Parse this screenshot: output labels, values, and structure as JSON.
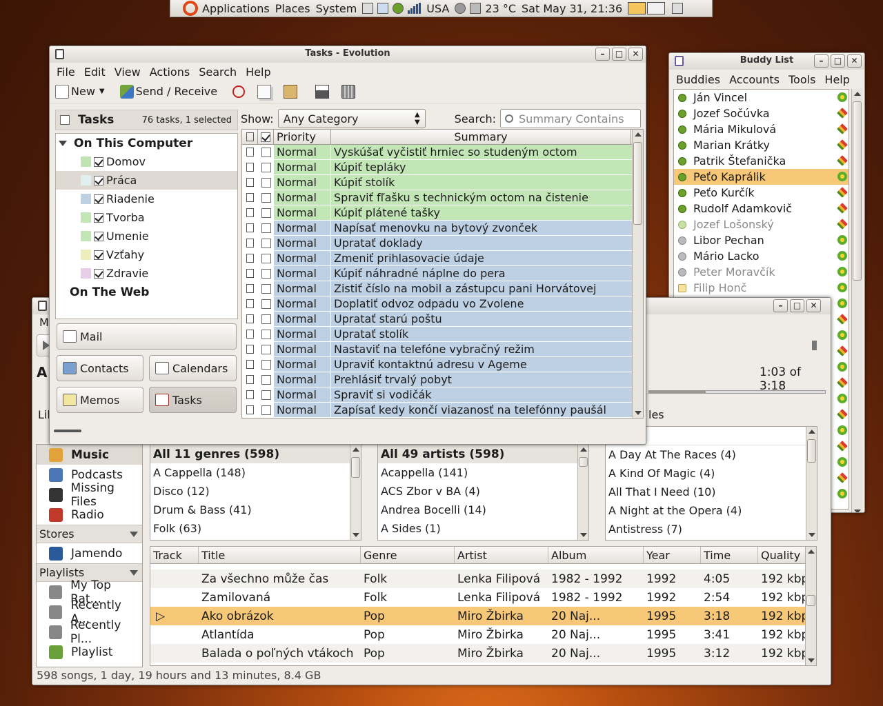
{
  "top_panel": {
    "menus": [
      "Applications",
      "Places",
      "System"
    ],
    "keyboard_layout": "USA",
    "temperature": "23 °C",
    "clock": "Sat May 31, 21:36"
  },
  "evolution": {
    "title": "Tasks - Evolution",
    "menu": [
      "File",
      "Edit",
      "View",
      "Actions",
      "Search",
      "Help"
    ],
    "toolbar": {
      "new_label": "New",
      "send_receive_label": "Send / Receive"
    },
    "sidebar": {
      "title": "Tasks",
      "count": "76 tasks, 1 selected",
      "groups": [
        "On This Computer",
        "On The Web"
      ],
      "lists": [
        {
          "label": "Domov",
          "color": "#bfe3b2",
          "checked": true
        },
        {
          "label": "Práca",
          "color": "#dff0ee",
          "checked": true
        },
        {
          "label": "Riadenie",
          "color": "#bdd0e4",
          "checked": true
        },
        {
          "label": "Tvorba",
          "color": "#c3e6b6",
          "checked": true
        },
        {
          "label": "Umenie",
          "color": "#c3e6b6",
          "checked": true
        },
        {
          "label": "Vzťahy",
          "color": "#eeeebd",
          "checked": true
        },
        {
          "label": "Zdravie",
          "color": "#e7cde7",
          "checked": true
        }
      ],
      "buttons": {
        "mail": "Mail",
        "contacts": "Contacts",
        "calendars": "Calendars",
        "memos": "Memos",
        "tasks": "Tasks"
      }
    },
    "filter": {
      "show_label": "Show:",
      "category": "Any Category",
      "search_label": "Search:",
      "search_placeholder": "Summary Contains"
    },
    "table": {
      "headers": [
        "Priority",
        "Summary"
      ],
      "rows": [
        {
          "priority": "Normal",
          "summary": "Vyskúšať vyčistiť hrniec so studeným octom",
          "color": "#c3e6b6"
        },
        {
          "priority": "Normal",
          "summary": "Kúpiť tepláky",
          "color": "#c3e6b6"
        },
        {
          "priority": "Normal",
          "summary": "Kúpiť stolík",
          "color": "#c3e6b6"
        },
        {
          "priority": "Normal",
          "summary": "Spraviť fľašku s technickým octom na čistenie",
          "color": "#c3e6b6"
        },
        {
          "priority": "Normal",
          "summary": "Kúpiť plátené tašky",
          "color": "#c3e6b6"
        },
        {
          "priority": "Normal",
          "summary": "Napísať menovku na bytový zvonček",
          "color": "#bdd0e4"
        },
        {
          "priority": "Normal",
          "summary": "Upratať doklady",
          "color": "#bdd0e4"
        },
        {
          "priority": "Normal",
          "summary": "Zmeniť prihlasovacie údaje",
          "color": "#bdd0e4"
        },
        {
          "priority": "Normal",
          "summary": "Kúpiť náhradné náplne do pera",
          "color": "#bdd0e4"
        },
        {
          "priority": "Normal",
          "summary": "Zistiť číslo na mobil a zástupcu pani Horvátovej",
          "color": "#bdd0e4"
        },
        {
          "priority": "Normal",
          "summary": "Doplatiť odvoz odpadu vo Zvolene",
          "color": "#bdd0e4"
        },
        {
          "priority": "Normal",
          "summary": "Upratať starú poštu",
          "color": "#bdd0e4"
        },
        {
          "priority": "Normal",
          "summary": "Upratať stolík",
          "color": "#bdd0e4"
        },
        {
          "priority": "Normal",
          "summary": "Nastaviť na telefóne vybračný režim",
          "color": "#bdd0e4"
        },
        {
          "priority": "Normal",
          "summary": "Upraviť kontaktnú adresu v Ageme",
          "color": "#bdd0e4"
        },
        {
          "priority": "Normal",
          "summary": "Prehlásiť trvalý pobyt",
          "color": "#bdd0e4"
        },
        {
          "priority": "Normal",
          "summary": "Spraviť si vodičák",
          "color": "#bdd0e4"
        },
        {
          "priority": "Normal",
          "summary": "Zapísať kedy končí viazanosť na telefónny paušál",
          "color": "#bdd0e4"
        }
      ]
    }
  },
  "buddy_list": {
    "title": "Buddy List",
    "menu": [
      "Buddies",
      "Accounts",
      "Tools",
      "Help"
    ],
    "buddies": [
      {
        "name": "Ján Vincel",
        "status": "online",
        "proto": "icq"
      },
      {
        "name": "Jozef Sočúvka",
        "status": "online",
        "proto": "gg"
      },
      {
        "name": "Mária Mikulová",
        "status": "online",
        "proto": "gg"
      },
      {
        "name": "Marian Krátky",
        "status": "online",
        "proto": "gg"
      },
      {
        "name": "Patrik Štefanička",
        "status": "online",
        "proto": "gg"
      },
      {
        "name": "Peťo Kaprálik",
        "status": "online",
        "proto": "icq",
        "selected": true
      },
      {
        "name": "Peťo Kurčík",
        "status": "online",
        "proto": "gg"
      },
      {
        "name": "Rudolf Adamkovič",
        "status": "online",
        "proto": "gg"
      },
      {
        "name": "Jozef Lošonský",
        "status": "away",
        "proto": "gg"
      },
      {
        "name": "Libor Pechan",
        "status": "offline",
        "proto": "icq"
      },
      {
        "name": "Mário Lacko",
        "status": "offline",
        "proto": "icq"
      },
      {
        "name": "Peter Moravčík",
        "status": "idle",
        "proto": "icq"
      },
      {
        "name": "Filip Honč",
        "status": "note",
        "proto": "icq"
      }
    ]
  },
  "rhythmbox": {
    "time": "1:03 of 3:18",
    "partial_menu": "M",
    "partial_title": "A",
    "partial_library": "Lib",
    "partial_tab": "les",
    "sources": [
      {
        "label": "Music",
        "selected": true,
        "icon": "music-note-icon"
      },
      {
        "label": "Podcasts",
        "icon": "podcast-icon"
      },
      {
        "label": "Missing Files",
        "icon": "missing-files-icon"
      },
      {
        "label": "Radio",
        "icon": "radio-icon"
      }
    ],
    "stores_label": "Stores",
    "stores": [
      {
        "label": "Jamendo",
        "icon": "jamendo-icon"
      }
    ],
    "playlists_label": "Playlists",
    "playlists": [
      {
        "label": "My Top Rat...",
        "icon": "smart-playlist-icon"
      },
      {
        "label": "Recently A...",
        "icon": "smart-playlist-icon"
      },
      {
        "label": "Recently Pl...",
        "icon": "smart-playlist-icon"
      },
      {
        "label": "Playlist",
        "icon": "playlist-icon"
      }
    ],
    "genres": {
      "header": "All 11 genres (598)",
      "items": [
        "A Cappella (148)",
        "Disco (12)",
        "Drum & Bass (41)",
        "Folk (63)"
      ]
    },
    "artists": {
      "header": "All 49 artists (598)",
      "items": [
        "Acappella (141)",
        "ACS Zbor v BA (4)",
        "Andrea Bocelli (14)",
        "A Sides (1)"
      ]
    },
    "albums": {
      "items": [
        "A Day At The Races (4)",
        "A Kind Of Magic (4)",
        "All That I Need (10)",
        "A Night at the Opera (4)",
        "Antistress (7)"
      ]
    },
    "song_headers": [
      "Track",
      "Title",
      "Genre",
      "Artist",
      "Album",
      "Year",
      "Time",
      "Quality"
    ],
    "songs": [
      {
        "track": "",
        "title": "Za všechno může čas",
        "genre": "Folk",
        "artist": "Lenka Filipová",
        "album": "1982 - 1992",
        "year": "1992",
        "time": "4:05",
        "quality": "192 kbps"
      },
      {
        "track": "",
        "title": "Zamilovaná",
        "genre": "Folk",
        "artist": "Lenka Filipová",
        "album": "1982 - 1992",
        "year": "1992",
        "time": "2:54",
        "quality": "192 kbps"
      },
      {
        "track": "▷",
        "title": "Ako obrázok",
        "genre": "Pop",
        "artist": "Miro Žbirka",
        "album": "20 Naj...",
        "year": "1995",
        "time": "3:18",
        "quality": "192 kbps",
        "playing": true
      },
      {
        "track": "",
        "title": "Atlantída",
        "genre": "Pop",
        "artist": "Miro Žbirka",
        "album": "20 Naj...",
        "year": "1995",
        "time": "3:41",
        "quality": "192 kbps"
      },
      {
        "track": "",
        "title": "Balada o poľných vtákoch",
        "genre": "Pop",
        "artist": "Miro Žbirka",
        "album": "20 Naj...",
        "year": "1995",
        "time": "3:12",
        "quality": "192 kbps"
      }
    ],
    "status": "598 songs, 1 day, 19 hours and 13 minutes, 8.4 GB"
  }
}
